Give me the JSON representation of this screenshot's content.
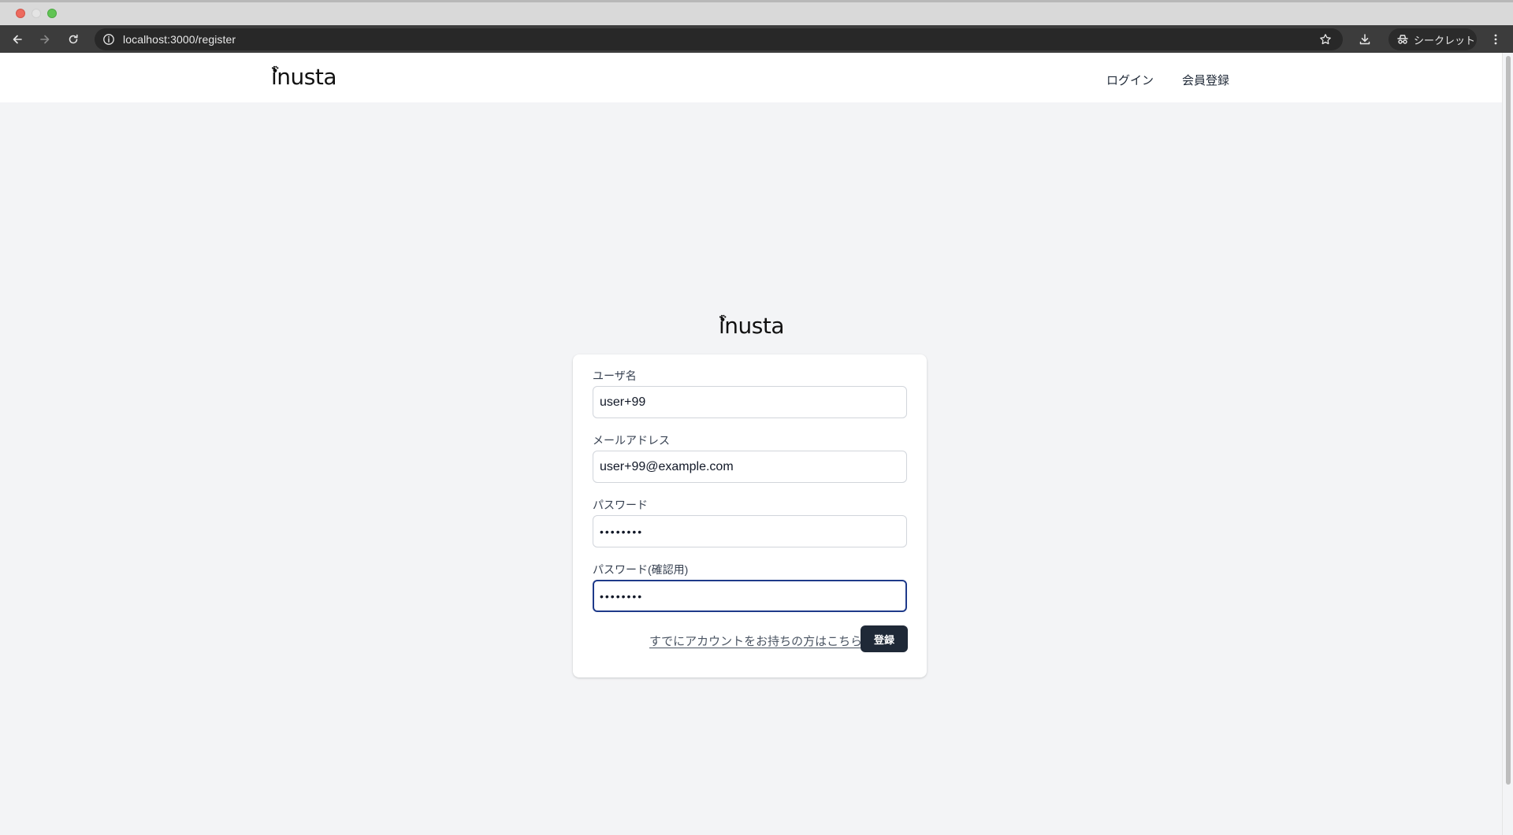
{
  "browser": {
    "url": "localhost:3000/register",
    "incognito_label": "シークレット"
  },
  "header": {
    "logo_text": "inusta",
    "nav": {
      "login": "ログイン",
      "register": "会員登録"
    }
  },
  "form": {
    "logo_text": "inusta",
    "fields": [
      {
        "label": "ユーザ名",
        "value": "user+99",
        "type": "text"
      },
      {
        "label": "メールアドレス",
        "value": "user+99@example.com",
        "type": "email"
      },
      {
        "label": "パスワード",
        "value": "••••••••",
        "type": "password"
      },
      {
        "label": "パスワード(確認用)",
        "value": "••••••••",
        "type": "password",
        "focused": true
      }
    ],
    "login_link": "すでにアカウントをお持ちの方はこちら",
    "submit_label": "登録"
  },
  "colors": {
    "page_bg": "#f3f4f6",
    "primary_button": "#1f2937",
    "focus_ring": "#1e3a8a",
    "chrome_toolbar": "#3c3c3c"
  },
  "icons": [
    "back-arrow-icon",
    "forward-arrow-icon",
    "reload-icon",
    "info-icon",
    "star-icon",
    "download-icon",
    "incognito-icon",
    "kebab-menu-icon",
    "paw-icon"
  ]
}
